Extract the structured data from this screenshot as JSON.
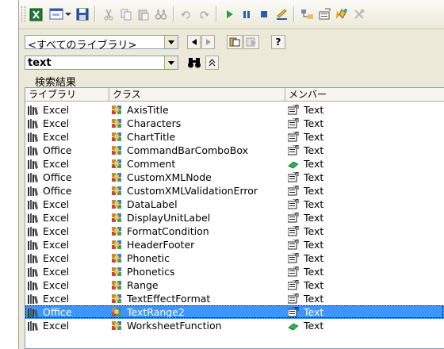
{
  "library_combo": {
    "value": "<すべてのライブラリ>"
  },
  "search_combo": {
    "value": "text"
  },
  "results": {
    "caption": "検索結果",
    "columns": [
      "ライブラリ",
      "クラス",
      "メンバー"
    ],
    "rows": [
      {
        "library": "Excel",
        "class": "AxisTitle",
        "member": "Text",
        "member_kind": "property",
        "selected": false
      },
      {
        "library": "Excel",
        "class": "Characters",
        "member": "Text",
        "member_kind": "property",
        "selected": false
      },
      {
        "library": "Excel",
        "class": "ChartTitle",
        "member": "Text",
        "member_kind": "property",
        "selected": false
      },
      {
        "library": "Office",
        "class": "CommandBarComboBox",
        "member": "Text",
        "member_kind": "property",
        "selected": false
      },
      {
        "library": "Excel",
        "class": "Comment",
        "member": "Text",
        "member_kind": "method",
        "selected": false
      },
      {
        "library": "Office",
        "class": "CustomXMLNode",
        "member": "Text",
        "member_kind": "property",
        "selected": false
      },
      {
        "library": "Office",
        "class": "CustomXMLValidationError",
        "member": "Text",
        "member_kind": "property",
        "selected": false
      },
      {
        "library": "Excel",
        "class": "DataLabel",
        "member": "Text",
        "member_kind": "property",
        "selected": false
      },
      {
        "library": "Excel",
        "class": "DisplayUnitLabel",
        "member": "Text",
        "member_kind": "property",
        "selected": false
      },
      {
        "library": "Excel",
        "class": "FormatCondition",
        "member": "Text",
        "member_kind": "property",
        "selected": false
      },
      {
        "library": "Excel",
        "class": "HeaderFooter",
        "member": "Text",
        "member_kind": "property",
        "selected": false
      },
      {
        "library": "Excel",
        "class": "Phonetic",
        "member": "Text",
        "member_kind": "property",
        "selected": false
      },
      {
        "library": "Excel",
        "class": "Phonetics",
        "member": "Text",
        "member_kind": "property",
        "selected": false
      },
      {
        "library": "Excel",
        "class": "Range",
        "member": "Text",
        "member_kind": "property",
        "selected": false
      },
      {
        "library": "Excel",
        "class": "TextEffectFormat",
        "member": "Text",
        "member_kind": "property",
        "selected": false
      },
      {
        "library": "Office",
        "class": "TextRange2",
        "member": "Text",
        "member_kind": "property",
        "selected": true
      },
      {
        "library": "Excel",
        "class": "WorksheetFunction",
        "member": "Text",
        "member_kind": "method",
        "selected": false
      }
    ]
  },
  "colors": {
    "selection": "#3d95ff",
    "window_bg": "#ece9d8",
    "border": "#7f9db9"
  }
}
